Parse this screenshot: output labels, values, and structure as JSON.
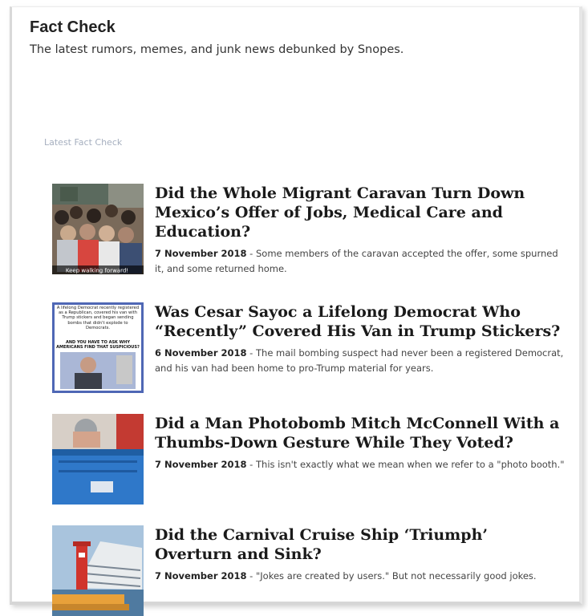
{
  "section": {
    "title": "Fact Check",
    "subtitle": "The latest rumors, memes, and junk news debunked by Snopes.",
    "latest_label": "Latest Fact Check"
  },
  "articles": [
    {
      "headline": "Did the Whole Migrant Caravan Turn Down Mexico’s Offer of Jobs, Medical Care and Education?",
      "date": "7 November 2018",
      "separator": " - ",
      "summary": "Some members of the caravan accepted the offer, some spurned it, and some returned home.",
      "thumb_caption": "Keep walking forward!"
    },
    {
      "headline": "Was Cesar Sayoc a Lifelong Democrat Who “Recently” Covered His Van in Trump Stickers?",
      "date": "6 November 2018",
      "separator": " - ",
      "summary": "The mail bombing suspect had never been a registered Democrat, and his van had been home to pro-Trump material for years.",
      "thumb_meme_text": "A lifelong Democrat recently registered as a Republican, covered his van with Trump stickers and began sending bombs that didn't explode to Democrats.",
      "thumb_meme_caption": "AND YOU HAVE TO ASK WHY AMERICANS FIND THAT SUSPICIOUS?"
    },
    {
      "headline": "Did a Man Photobomb Mitch McConnell With a Thumbs-Down Gesture While They Voted?",
      "date": "7 November 2018",
      "separator": " - ",
      "summary": "This isn't exactly what we mean when we refer to a \"photo booth.\""
    },
    {
      "headline": "Did the Carnival Cruise Ship ‘Triumph’ Overturn and Sink?",
      "date": "7 November 2018",
      "separator": " - ",
      "summary": "\"Jokes are created by users.\" But not necessarily good jokes."
    }
  ]
}
